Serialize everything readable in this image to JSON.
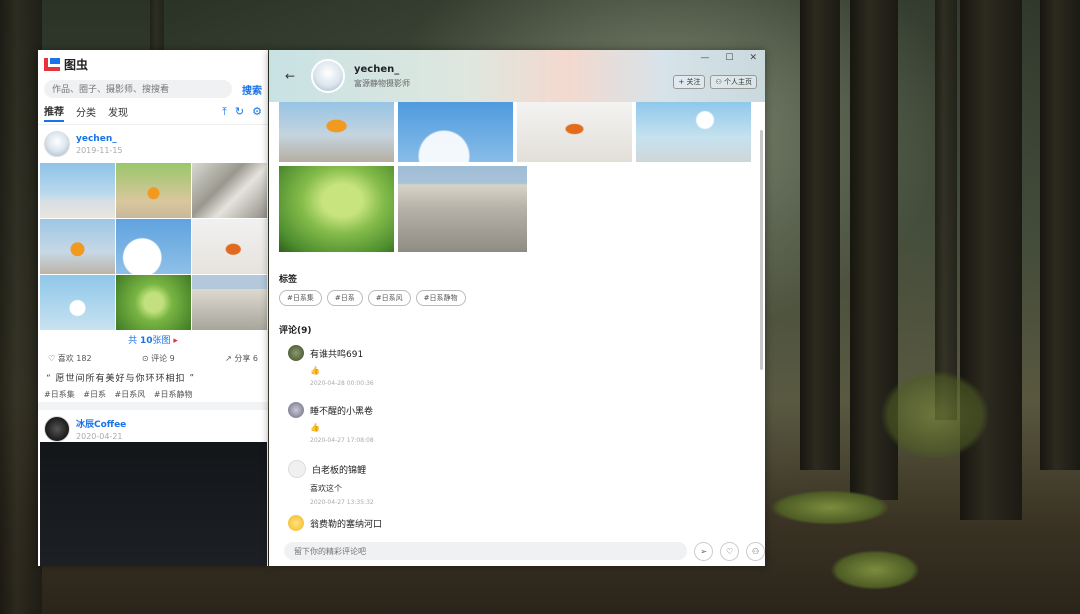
{
  "left": {
    "brand": "图虫",
    "search_placeholder": "作品、圈子、摄影师、搜搜看",
    "search_label": "搜索",
    "tabs": [
      "推荐",
      "分类",
      "发现"
    ],
    "post1": {
      "user": "yechen_",
      "date": "2019-11-15",
      "more_prefix": "共",
      "more_count": "10",
      "more_suffix": "张图",
      "likes": "喜欢 182",
      "comments": "评论 9",
      "shares": "分享 6",
      "quote": "“ 愿世间所有美好与你环环相扣 ”",
      "tags": [
        "#日系集",
        "#日系",
        "#日系风",
        "#日系静物"
      ]
    },
    "post2": {
      "user": "冰辰Coffee",
      "date": "2020-04-21"
    }
  },
  "right": {
    "user": "yechen_",
    "subtitle": "富源静物摄影师",
    "follow_label": "+ 关注",
    "home_label": "个人主页",
    "tags_title": "标签",
    "tags": [
      "#日系集",
      "#日系",
      "#日系风",
      "#日系静物"
    ],
    "comments_title": "评论(9)",
    "comments": [
      {
        "name": "有谁共鸣691",
        "body": "👍",
        "time": "2020-04-28 00:00:36"
      },
      {
        "name": "睡不醒的小黑卷",
        "body": "👍",
        "time": "2020-04-27 17:08:08"
      },
      {
        "name": "白老板的锦鲤",
        "body": "喜欢这个",
        "time": "2020-04-27 13:35:32"
      },
      {
        "name": "翁费勒的塞纳河口",
        "body": "",
        "time": ""
      }
    ],
    "comment_placeholder": "留下你的精彩评论吧"
  },
  "icons": {
    "back": "arrow-left-icon",
    "send": "send-icon",
    "heart": "heart-icon",
    "user": "user-icon"
  },
  "colors": {
    "accent": "#1a73e8"
  }
}
